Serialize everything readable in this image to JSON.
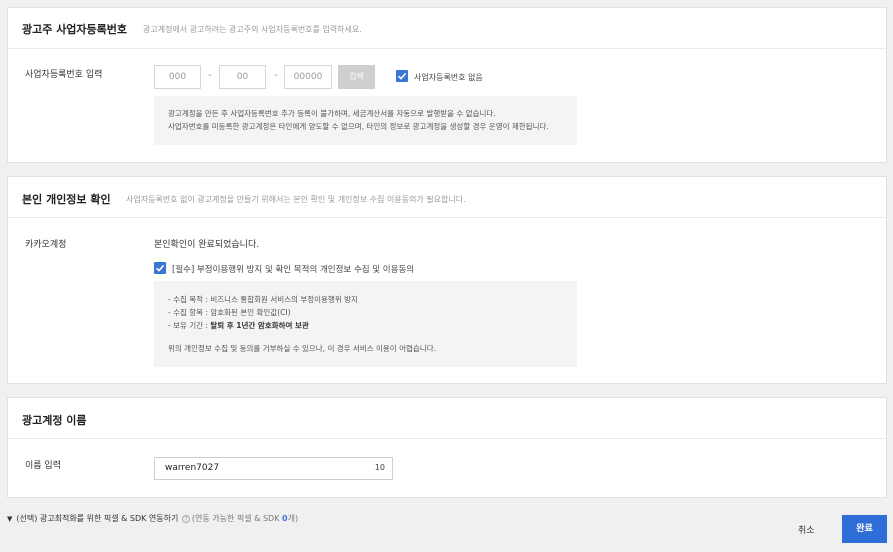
{
  "biz": {
    "title": "광고주 사업자등록번호",
    "desc": "광고계정에서 광고하려는 광고주의 사업자등록번호를 입력하세요.",
    "label": "사업자등록번호 입력",
    "part1_placeholder": "000",
    "part2_placeholder": "00",
    "part3_placeholder": "00000",
    "dash": "-",
    "check_label": "검색",
    "no_biz_label": "사업자등록번호 없음",
    "no_biz_checked": true,
    "notice": [
      "광고계정을 만든 후 사업자등록번호 추가 등록이 불가하며, 세금계산서를 자동으로 발행받을 수 없습니다.",
      "사업자번호를 미등록한 광고계정은 타인에게 양도할 수 없으며, 타인의 정보로 광고계정을 생성할 경우 운영이 제한됩니다."
    ]
  },
  "identity": {
    "title": "본인 개인정보 확인",
    "desc": "사업자등록번호 없이 광고계정을 만들기 위해서는 본인 확인 및 개인정보 수집 이용동의가 필요합니다.",
    "label": "카카오계정",
    "verified_text": "본인확인이 완료되었습니다.",
    "consent_label": "[필수] 부정이용행위 방지 및 확인 목적의 개인정보 수집 및 이용동의",
    "consent_checked": true,
    "purpose": "- 수집 목적 : 비즈니스 통합회원 서비스의 부정이용행위 방지",
    "items": "- 수집 항목 : 암호화된 본인 확인값(CI)",
    "period_prefix": "- 보유 기간 : ",
    "period_bold": "탈퇴 후 1년간 암호화하여 보관",
    "refuse_text": "위의 개인정보 수집 및 동의를 거부하실 수 있으나, 이 경우 서비스 이용이 어렵습니다."
  },
  "account_name": {
    "title": "광고계정 이름",
    "label": "이름 입력",
    "value": "warren7027",
    "char_count": "10"
  },
  "pixel": {
    "toggle_label": "(선택) 광고최적화를 위한 픽셀 & SDK 연동하기",
    "help_icon": "question-icon",
    "sub_prefix": "(연동 가능한 픽셀 & SDK ",
    "sub_count": "0",
    "sub_suffix": "개)"
  },
  "footer": {
    "cancel_label": "취소",
    "done_label": "완료"
  },
  "colors": {
    "accent": "#2f6ed6",
    "checkbox": "#3a76d4"
  }
}
